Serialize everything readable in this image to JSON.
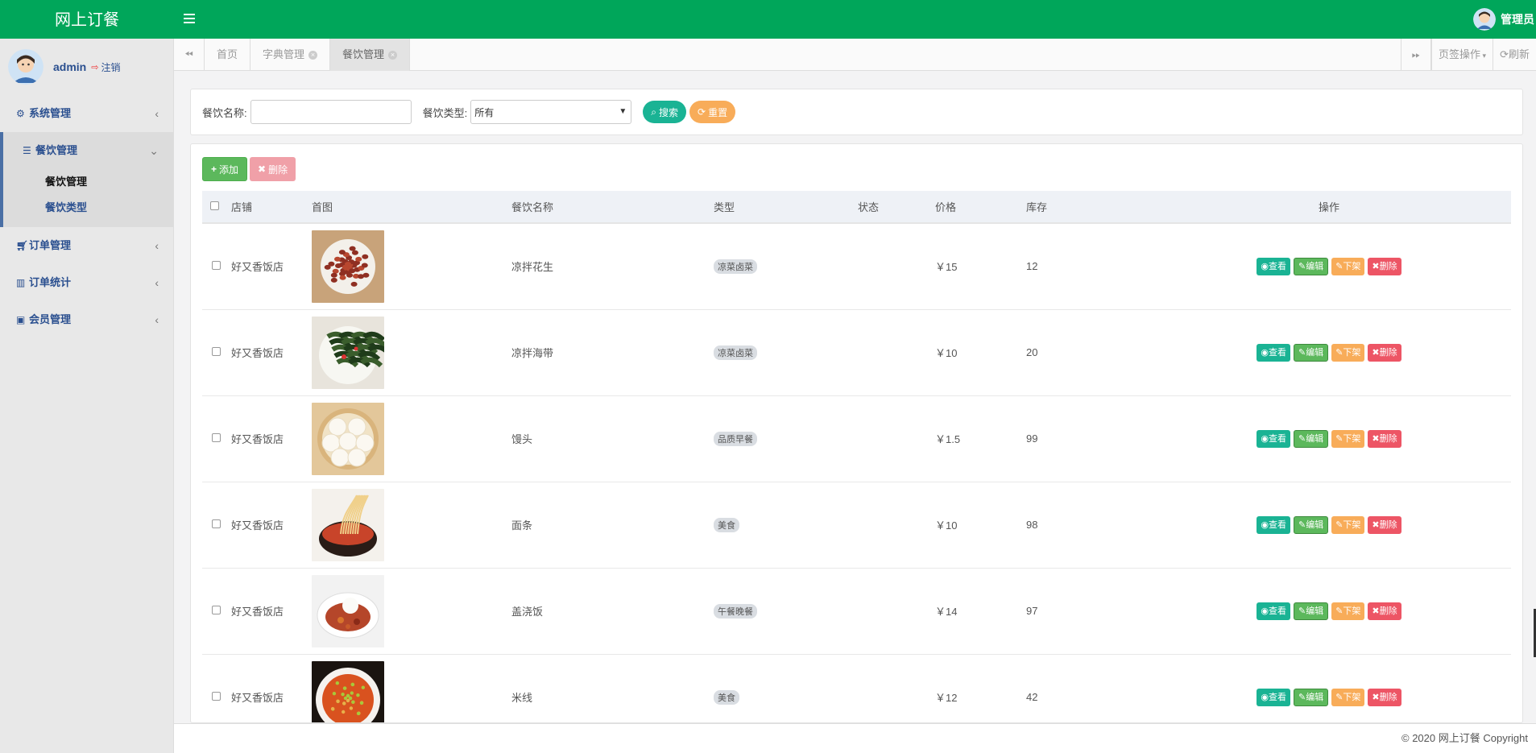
{
  "app": {
    "title": "网上订餐",
    "top_user": "管理员"
  },
  "sidebar": {
    "username": "admin",
    "logout": "注销",
    "menus": [
      {
        "label": "系统管理",
        "icon": "gear-icon"
      },
      {
        "label": "餐饮管理",
        "icon": "list-icon",
        "open": true,
        "children": [
          {
            "label": "餐饮管理",
            "active": true
          },
          {
            "label": "餐饮类型",
            "active": false
          }
        ]
      },
      {
        "label": "订单管理",
        "icon": "cart-icon"
      },
      {
        "label": "订单统计",
        "icon": "bar-chart-icon"
      },
      {
        "label": "会员管理",
        "icon": "user-card-icon"
      }
    ]
  },
  "tabs": {
    "items": [
      {
        "label": "首页",
        "closable": false,
        "active": false
      },
      {
        "label": "字典管理",
        "closable": true,
        "active": false
      },
      {
        "label": "餐饮管理",
        "closable": true,
        "active": true
      }
    ],
    "page_ops": "页签操作",
    "refresh": "刷新"
  },
  "search": {
    "name_label": "餐饮名称:",
    "name_value": "",
    "type_label": "餐饮类型:",
    "type_value": "所有",
    "search_btn": "搜索",
    "reset_btn": "重置"
  },
  "toolbar": {
    "add": "添加",
    "delete": "删除"
  },
  "table": {
    "columns": [
      "店铺",
      "首图",
      "餐饮名称",
      "类型",
      "状态",
      "价格",
      "库存",
      "操作"
    ],
    "rows": [
      {
        "shop": "好又香饭店",
        "name": "凉拌花生",
        "type": "凉菜卤菜",
        "status": "",
        "price": "￥15",
        "stock": "12",
        "img": "peanuts"
      },
      {
        "shop": "好又香饭店",
        "name": "凉拌海带",
        "type": "凉菜卤菜",
        "status": "",
        "price": "￥10",
        "stock": "20",
        "img": "seaweed"
      },
      {
        "shop": "好又香饭店",
        "name": "馒头",
        "type": "品质早餐",
        "status": "",
        "price": "￥1.5",
        "stock": "99",
        "img": "buns"
      },
      {
        "shop": "好又香饭店",
        "name": "面条",
        "type": "美食",
        "status": "",
        "price": "￥10",
        "stock": "98",
        "img": "noodles"
      },
      {
        "shop": "好又香饭店",
        "name": "盖浇饭",
        "type": "午餐晚餐",
        "status": "",
        "price": "￥14",
        "stock": "97",
        "img": "rice"
      },
      {
        "shop": "好又香饭店",
        "name": "米线",
        "type": "美食",
        "status": "",
        "price": "￥12",
        "stock": "42",
        "img": "ricenoodle"
      }
    ],
    "op_labels": {
      "view": "查看",
      "edit": "编辑",
      "off": "下架",
      "del": "删除"
    }
  },
  "footer": {
    "copyright": "© 2020 网上订餐 Copyright"
  },
  "colors": {
    "header": "#00a65a",
    "primary": "#1ab394",
    "warning": "#f8ac59",
    "danger": "#ed5565",
    "success": "#5cb85c"
  }
}
